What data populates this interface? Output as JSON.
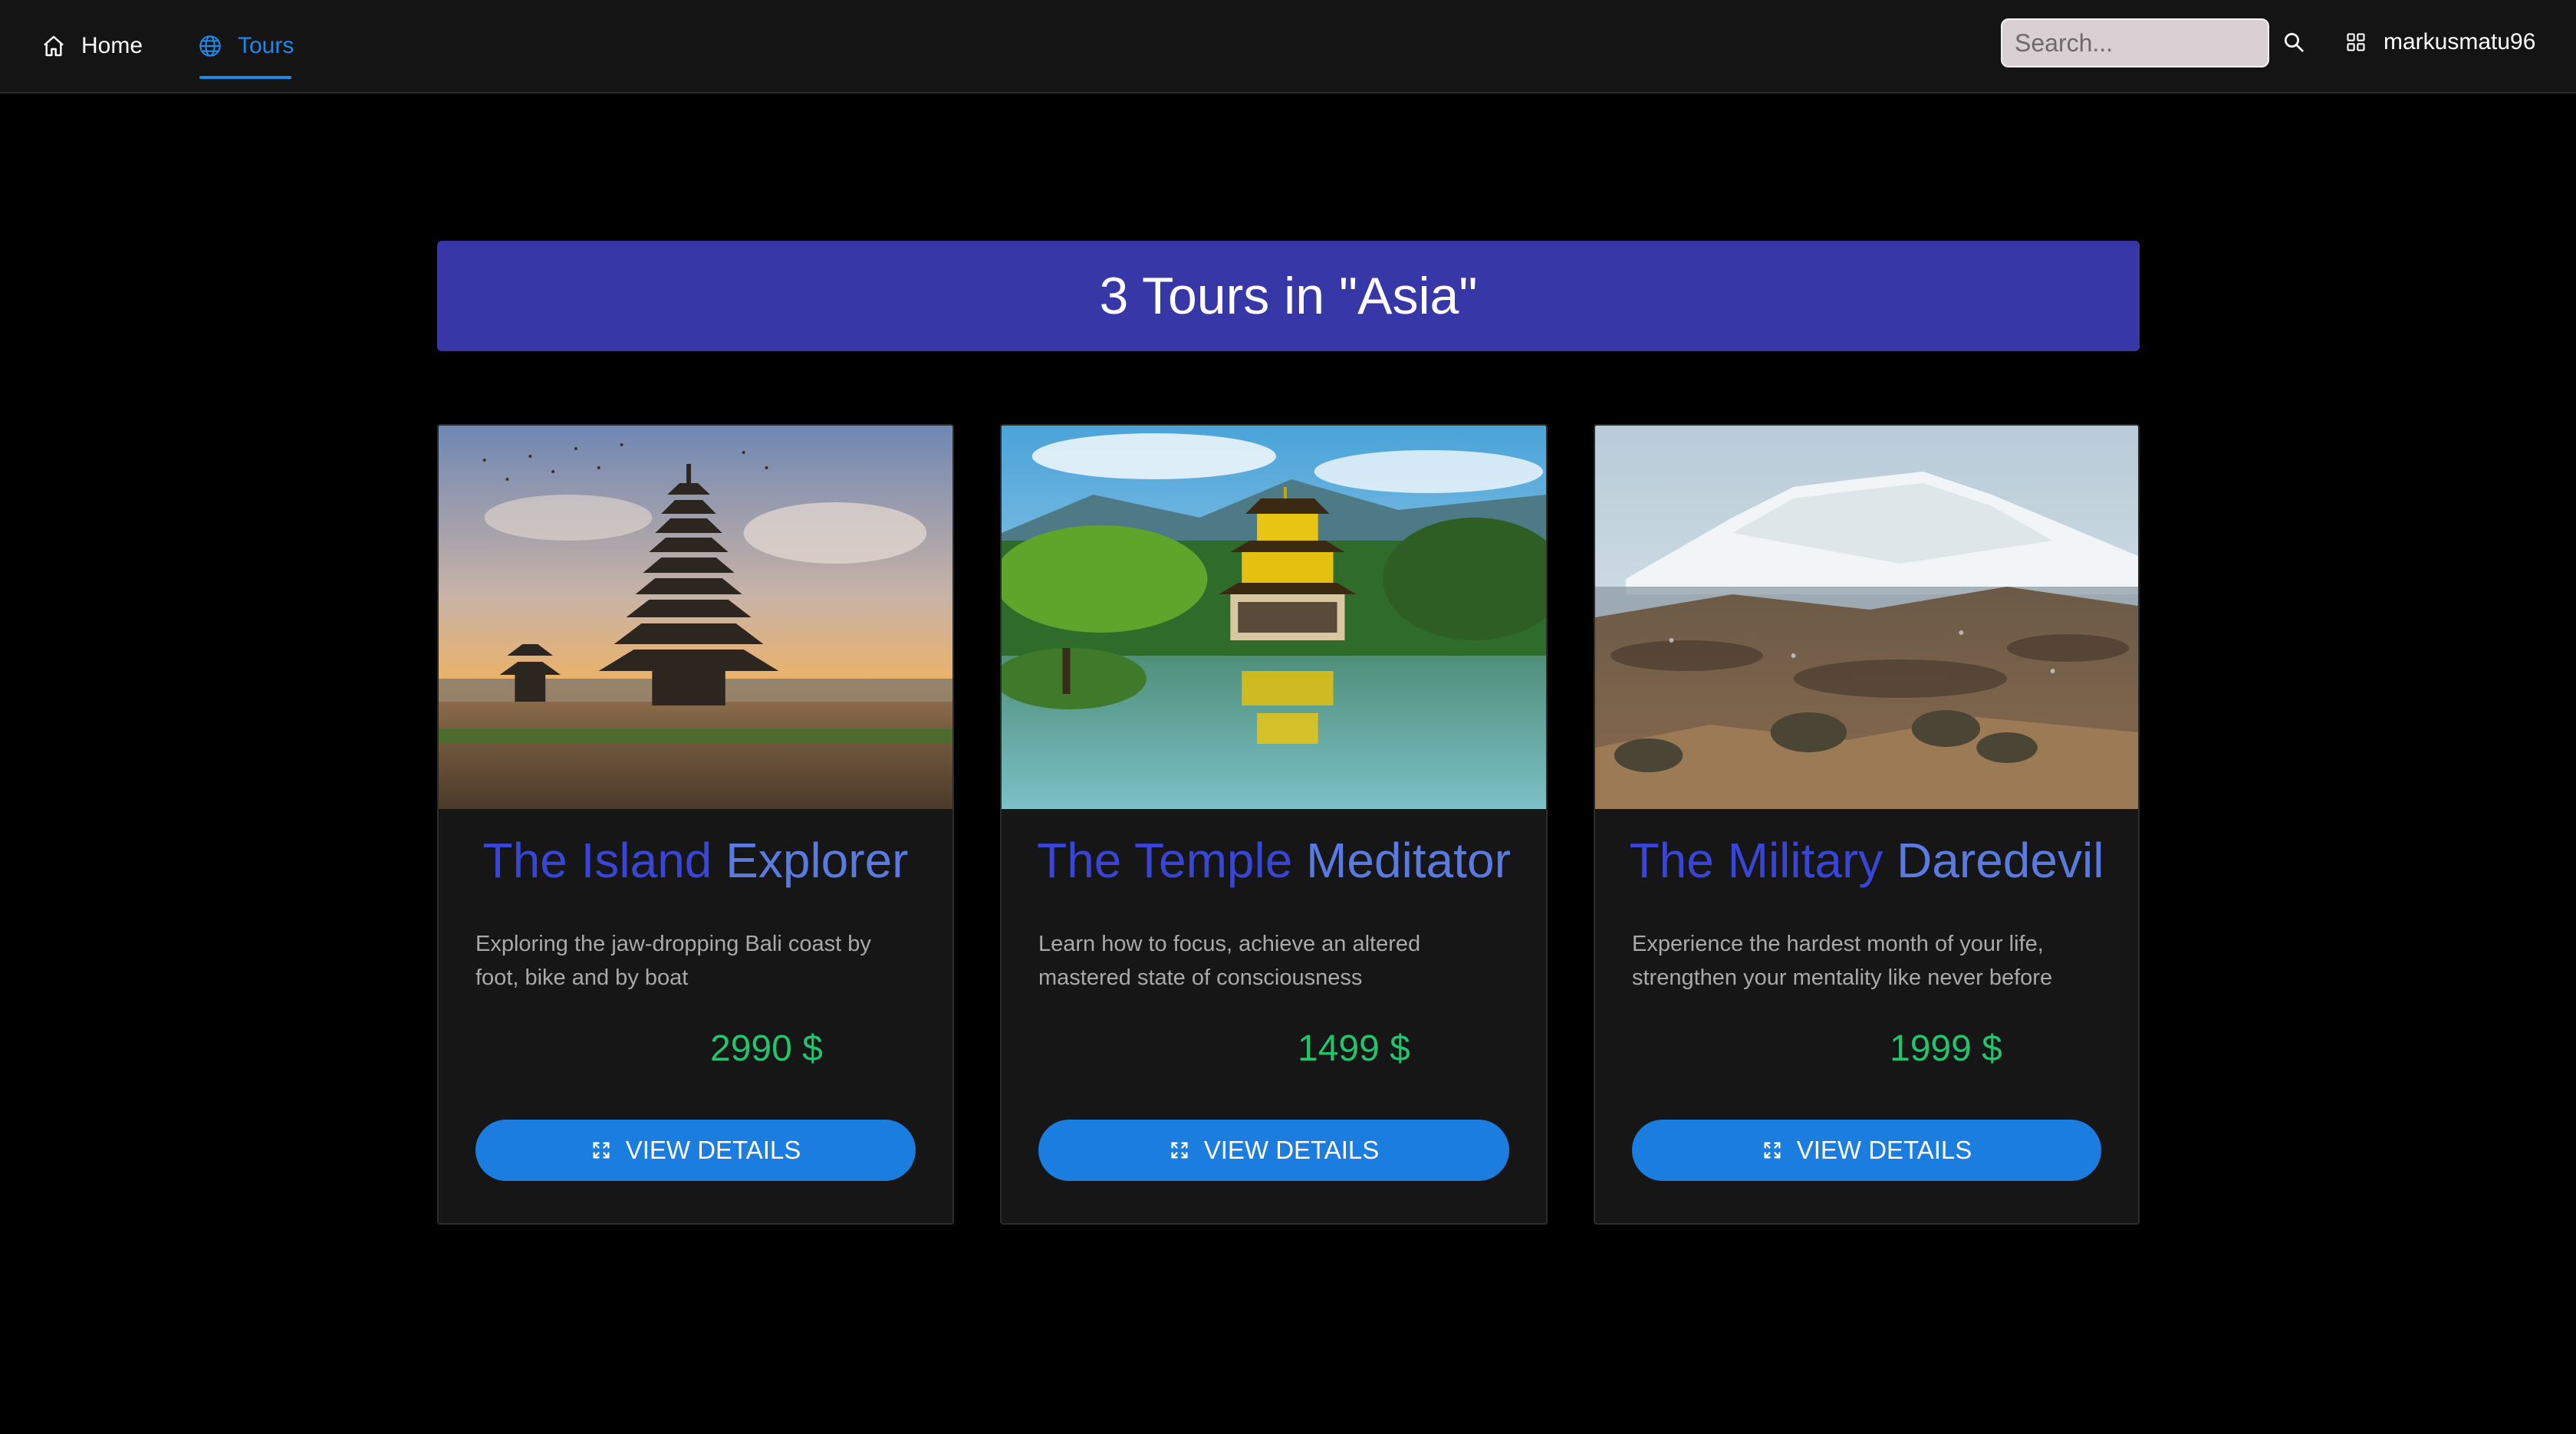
{
  "nav": {
    "home_label": "Home",
    "tours_label": "Tours",
    "active_tab": "Tours",
    "search_placeholder": "Search...",
    "username": "markusmatu96",
    "icons": {
      "home": "home-icon",
      "tours": "globe-icon",
      "search": "search-icon",
      "user_menu": "grid-icon"
    },
    "accent_color": "#1e88e5"
  },
  "banner": {
    "heading": "3 Tours in \"Asia\"",
    "color": "#3837a8"
  },
  "tours": [
    {
      "title_first": "The Island",
      "title_second": "Explorer",
      "description": "Exploring the jaw-dropping Bali coast by foot, bike and by boat",
      "price": "2990 $",
      "button_label": "VIEW DETAILS",
      "image": "bali-pagoda-temple-photo"
    },
    {
      "title_first": "The Temple",
      "title_second": "Meditator",
      "description": "Learn how to focus, achieve an altered mastered state of consciousness",
      "price": "1499 $",
      "button_label": "VIEW DETAILS",
      "image": "golden-pavilion-temple-photo"
    },
    {
      "title_first": "The Military",
      "title_second": "Daredevil",
      "description": "Experience the hardest month of your life, strengthen your mentality like never before",
      "price": "1999 $",
      "button_label": "VIEW DETAILS",
      "image": "soldiers-volcano-landscape-photo"
    }
  ],
  "colors": {
    "price": "#22c46d",
    "button": "#1a7ddf",
    "title_primary": "#3845d6",
    "title_secondary": "#5b7ae0"
  }
}
